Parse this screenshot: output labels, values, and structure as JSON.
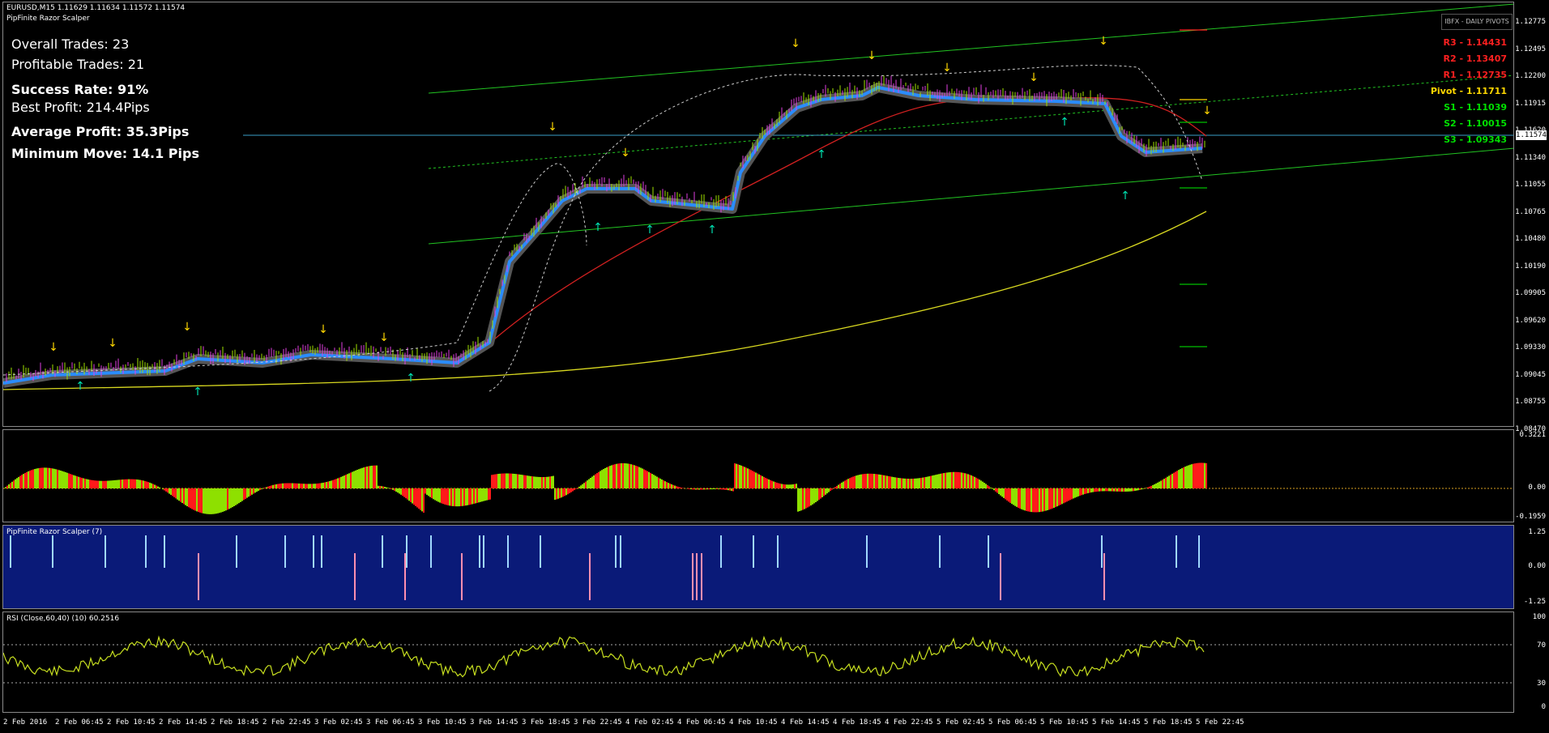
{
  "header": {
    "symbol_line": "EURUSD,M15  1.11629 1.11634 1.11572 1.11574",
    "indicator_name": "PipFinite Razor Scalper"
  },
  "stats": {
    "overall": "Overall Trades: 23",
    "profitable": "Profitable Trades: 21",
    "success": "Success Rate: 91%",
    "best": "Best Profit: 214.4Pips",
    "average": "Average Profit: 35.3Pips",
    "minimum": "Minimum Move: 14.1 Pips"
  },
  "pivots": {
    "panel_title": "IBFX - DAILY PIVOTS",
    "r3": "R3 - 1.14431",
    "r2": "R2 - 1.13407",
    "r1": "R1 - 1.12735",
    "pivot": "Pivot - 1.11711",
    "s1": "S1 - 1.11039",
    "s2": "S2 - 1.10015",
    "s3": "S3 - 1.09343",
    "colors": {
      "resistance": "#ff2020",
      "pivot": "#ffd700",
      "support": "#00e000"
    }
  },
  "current_price": "1.11574",
  "price_axis": [
    "1.12775",
    "1.12495",
    "1.12200",
    "1.11915",
    "1.11620",
    "1.11340",
    "1.11055",
    "1.10765",
    "1.10480",
    "1.10190",
    "1.09905",
    "1.09620",
    "1.09330",
    "1.09045",
    "1.08755",
    "1.08470"
  ],
  "hist_panel": {
    "ticks": [
      "0.3221",
      "0.00",
      "-0.1959"
    ]
  },
  "razor_panel": {
    "title": "PipFinite Razor Scalper (7)",
    "ticks": [
      "1.25",
      "0.00",
      "-1.25"
    ]
  },
  "rsi_panel": {
    "title": "RSI (Close,60,40) (10) 60.2516",
    "ticks": [
      "100",
      "70",
      "30",
      "0"
    ]
  },
  "time_axis": [
    "2 Feb 2016",
    "2 Feb 06:45",
    "2 Feb 10:45",
    "2 Feb 14:45",
    "2 Feb 18:45",
    "2 Feb 22:45",
    "3 Feb 02:45",
    "3 Feb 06:45",
    "3 Feb 10:45",
    "3 Feb 14:45",
    "3 Feb 18:45",
    "3 Feb 22:45",
    "4 Feb 02:45",
    "4 Feb 06:45",
    "4 Feb 10:45",
    "4 Feb 14:45",
    "4 Feb 18:45",
    "4 Feb 22:45",
    "5 Feb 02:45",
    "5 Feb 06:45",
    "5 Feb 10:45",
    "5 Feb 14:45",
    "5 Feb 18:45",
    "5 Feb 22:45"
  ]
}
